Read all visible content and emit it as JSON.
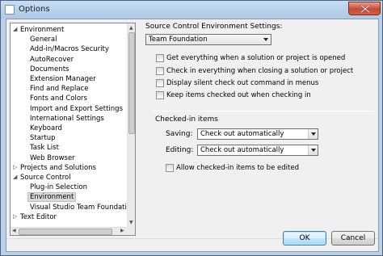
{
  "window": {
    "title": "Options",
    "close_icon": "close-x-icon"
  },
  "tree": {
    "items": [
      {
        "label": "Environment",
        "arrow": "◢",
        "level": 0
      },
      {
        "label": "General",
        "level": 1
      },
      {
        "label": "Add-in/Macros Security",
        "level": 1
      },
      {
        "label": "AutoRecover",
        "level": 1
      },
      {
        "label": "Documents",
        "level": 1
      },
      {
        "label": "Extension Manager",
        "level": 1
      },
      {
        "label": "Find and Replace",
        "level": 1
      },
      {
        "label": "Fonts and Colors",
        "level": 1
      },
      {
        "label": "Import and Export Settings",
        "level": 1
      },
      {
        "label": "International Settings",
        "level": 1
      },
      {
        "label": "Keyboard",
        "level": 1
      },
      {
        "label": "Startup",
        "level": 1
      },
      {
        "label": "Task List",
        "level": 1
      },
      {
        "label": "Web Browser",
        "level": 1
      },
      {
        "label": "Projects and Solutions",
        "arrow": "▷",
        "level": 0
      },
      {
        "label": "Source Control",
        "arrow": "◢",
        "level": 0
      },
      {
        "label": "Plug-in Selection",
        "level": 1
      },
      {
        "label": "Environment",
        "level": 1,
        "selected": true
      },
      {
        "label": "Visual Studio Team Foundation",
        "level": 1
      },
      {
        "label": "Text Editor",
        "arrow": "▷",
        "level": 0
      }
    ]
  },
  "settings": {
    "heading": "Source Control Environment Settings:",
    "environment_value": "Team Foundation",
    "checkboxes": [
      {
        "label": "Get everything when a solution or project is opened",
        "checked": false
      },
      {
        "label": "Check in everything when closing a solution or project",
        "checked": false
      },
      {
        "label": "Display silent check out command in menus",
        "checked": false
      },
      {
        "label": "Keep items checked out when checking in",
        "checked": false
      }
    ],
    "checked_in_heading": "Checked-in items",
    "saving_label": "Saving:",
    "saving_value": "Check out automatically",
    "editing_label": "Editing:",
    "editing_value": "Check out automatically",
    "allow_edit_label": "Allow checked-in items to be edited",
    "allow_edit_checked": false
  },
  "buttons": {
    "ok": "OK",
    "cancel": "Cancel"
  }
}
